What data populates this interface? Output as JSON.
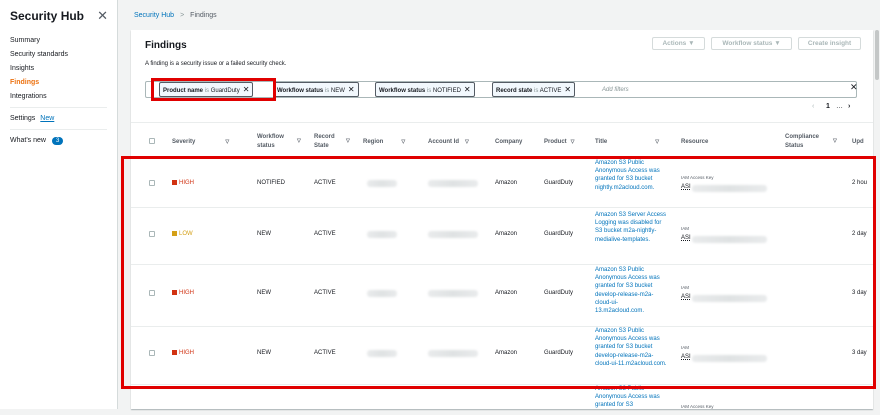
{
  "sidebar": {
    "title": "Security Hub",
    "items": [
      "Summary",
      "Security standards",
      "Insights",
      "Findings",
      "Integrations"
    ],
    "settings_label": "Settings",
    "new_label": "New",
    "whats_new": "What's new",
    "whats_new_count": "3"
  },
  "breadcrumb": {
    "root": "Security Hub",
    "current": "Findings"
  },
  "findings": {
    "title": "Findings",
    "description": "A finding is a security issue or a failed security check.",
    "actions_label": "Actions ▼",
    "workflow_status_label": "Workflow status ▼",
    "create_insight_label": "Create insight",
    "add_filters_placeholder": "Add filters",
    "filters": [
      {
        "field": "Product name",
        "op": "is",
        "value": "GuardDuty"
      },
      {
        "field": "Workflow status",
        "op": "is",
        "value": "NEW"
      },
      {
        "field": "Workflow status",
        "op": "is",
        "value": "NOTIFIED"
      },
      {
        "field": "Record state",
        "op": "is",
        "value": "ACTIVE"
      }
    ],
    "pager": {
      "prev": "‹",
      "page": "1",
      "ellipsis": "…",
      "next": "›"
    }
  },
  "table": {
    "columns": [
      "Severity",
      "Workflow status",
      "Record State",
      "Region",
      "Account Id",
      "Company",
      "Product",
      "Title",
      "Resource",
      "Compliance Status",
      "Upd"
    ],
    "rows": [
      {
        "severity": "HIGH",
        "workflow": "NOTIFIED",
        "record": "ACTIVE",
        "company": "Amazon",
        "product": "GuardDuty",
        "title": "Amazon S3 Public Anonymous Access was granted for S3 bucket nightly.m2acloud.com.",
        "res_type": "IAM Access Key",
        "res_id": "ASI",
        "updated": "2 hou"
      },
      {
        "severity": "LOW",
        "workflow": "NEW",
        "record": "ACTIVE",
        "company": "Amazon",
        "product": "GuardDuty",
        "title": "Amazon S3 Server Access Logging was disabled for S3 bucket m2a-nightly-medialive-templates.",
        "res_type": "IAM",
        "res_id": "ASI",
        "updated": "2 day"
      },
      {
        "severity": "HIGH",
        "workflow": "NEW",
        "record": "ACTIVE",
        "company": "Amazon",
        "product": "GuardDuty",
        "title": "Amazon S3 Public Anonymous Access was granted for S3 bucket develop-release-m2a-cloud-ui-13.m2acloud.com.",
        "res_type": "IAM",
        "res_id": "ASI",
        "updated": "3 day"
      },
      {
        "severity": "HIGH",
        "workflow": "NEW",
        "record": "ACTIVE",
        "company": "Amazon",
        "product": "GuardDuty",
        "title": "Amazon S3 Public Anonymous Access was granted for S3 bucket develop-release-m2a-cloud-ui-11.m2acloud.com.",
        "res_type": "IAM",
        "res_id": "ASI",
        "updated": "3 day"
      },
      {
        "title": "Amazon S3 Public Anonymous Access was granted for S3",
        "res_type": "IAM Access Key"
      }
    ]
  },
  "colors": {
    "high": "#d13212",
    "low": "#d4a017",
    "accent": "#ec7211",
    "link": "#0073bb",
    "highlight": "#e00000"
  }
}
